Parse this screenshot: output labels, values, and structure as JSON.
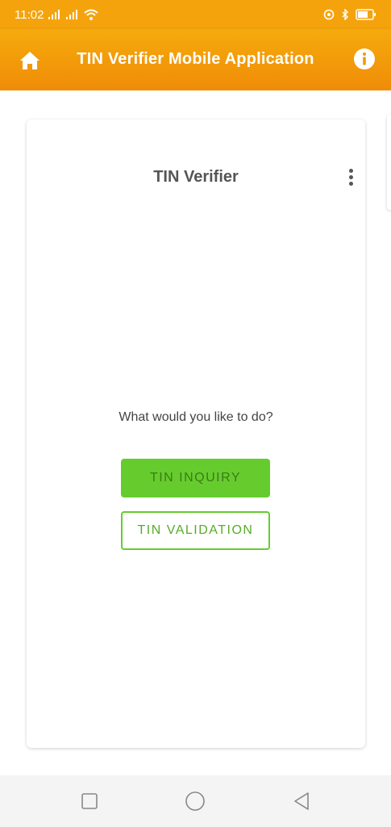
{
  "status_bar": {
    "time": "11:02"
  },
  "app_bar": {
    "title": "TIN Verifier Mobile Application",
    "home_icon": "home-icon",
    "info_icon": "info-icon"
  },
  "card": {
    "title": "TIN Verifier",
    "menu_icon": "more-vertical-icon",
    "prompt": "What would you like to do?",
    "buttons": [
      {
        "label": "TIN INQUIRY"
      },
      {
        "label": "TIN VALIDATION"
      }
    ]
  },
  "colors": {
    "header": "#f5a30d",
    "accent_green": "#66cc2e"
  },
  "nav_bar": {
    "icons": [
      "recents-square-icon",
      "home-circle-icon",
      "back-triangle-icon"
    ]
  }
}
